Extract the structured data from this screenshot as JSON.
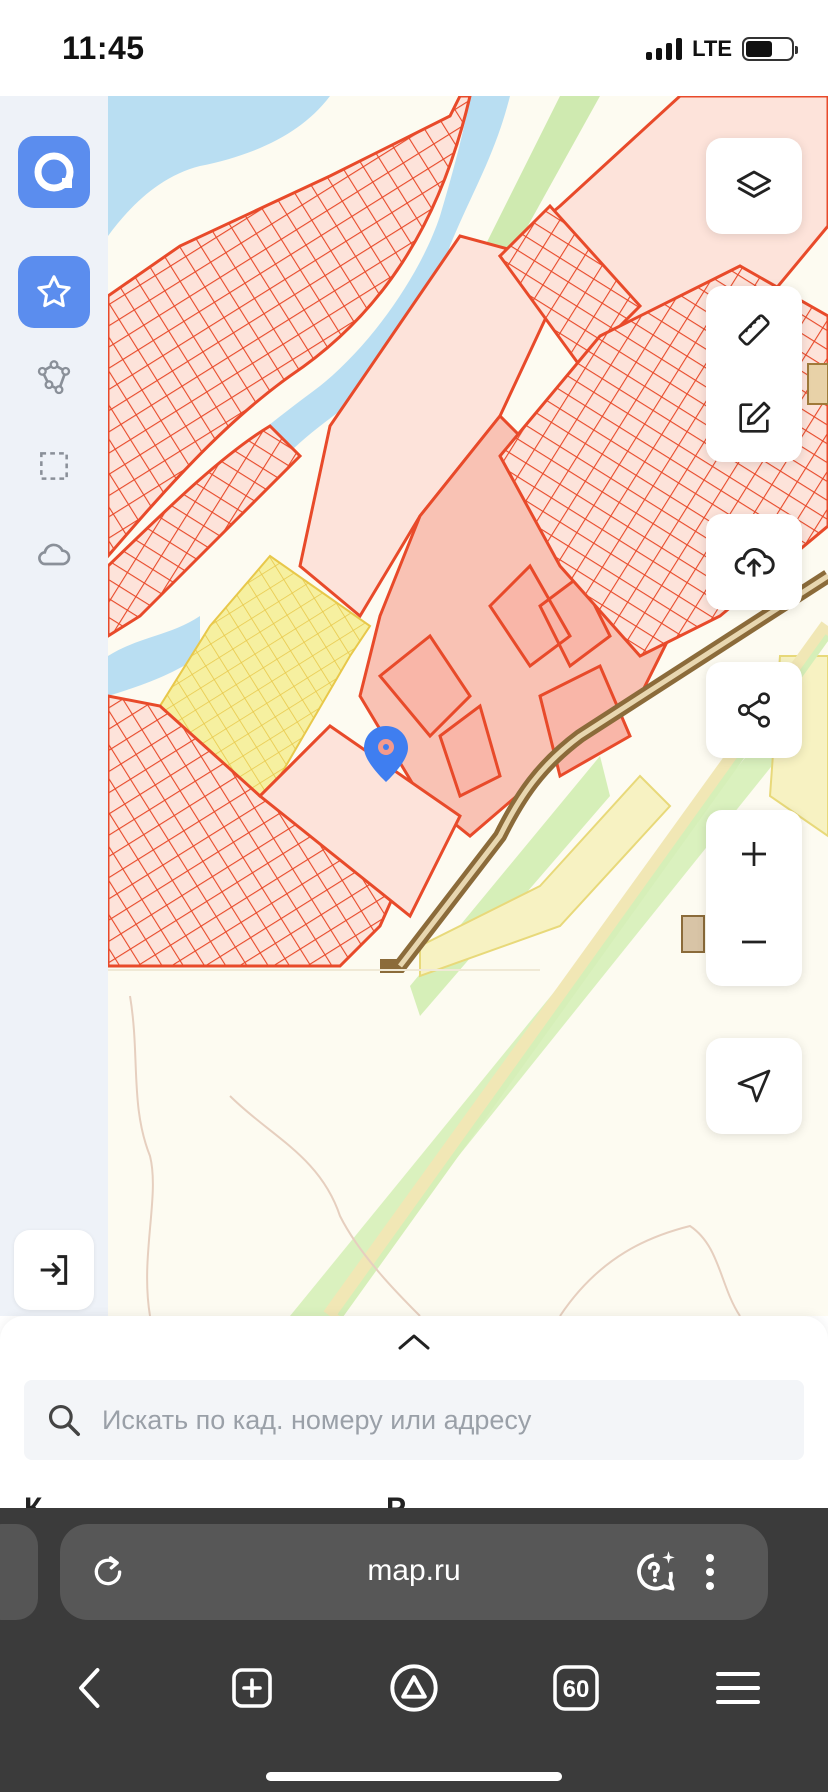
{
  "status_bar": {
    "time": "11:45",
    "network": "LTE"
  },
  "search": {
    "placeholder": "Искать по кад. номеру или адресу"
  },
  "sheet_peek": {
    "left": "К",
    "right": "Р"
  },
  "browser": {
    "url": "map.ru",
    "tabs_count": "60"
  },
  "colors": {
    "accent": "#5b8dee",
    "parcel_stroke": "#e84a2a",
    "parcel_fill": "#fde3da",
    "parcel_fill_dark": "#f9b6a8",
    "garden_fill": "#f6f0a0",
    "water": "#b9def2",
    "road": "#8b6b3a"
  },
  "icons": {
    "sidebar": [
      "app-logo-icon",
      "star-icon",
      "polygon-icon",
      "selection-icon",
      "cloud-icon",
      "login-icon"
    ],
    "controls": [
      "layers-icon",
      "ruler-icon",
      "edit-icon",
      "upload-icon",
      "share-icon",
      "zoom-in-icon",
      "zoom-out-icon",
      "locate-icon"
    ]
  }
}
